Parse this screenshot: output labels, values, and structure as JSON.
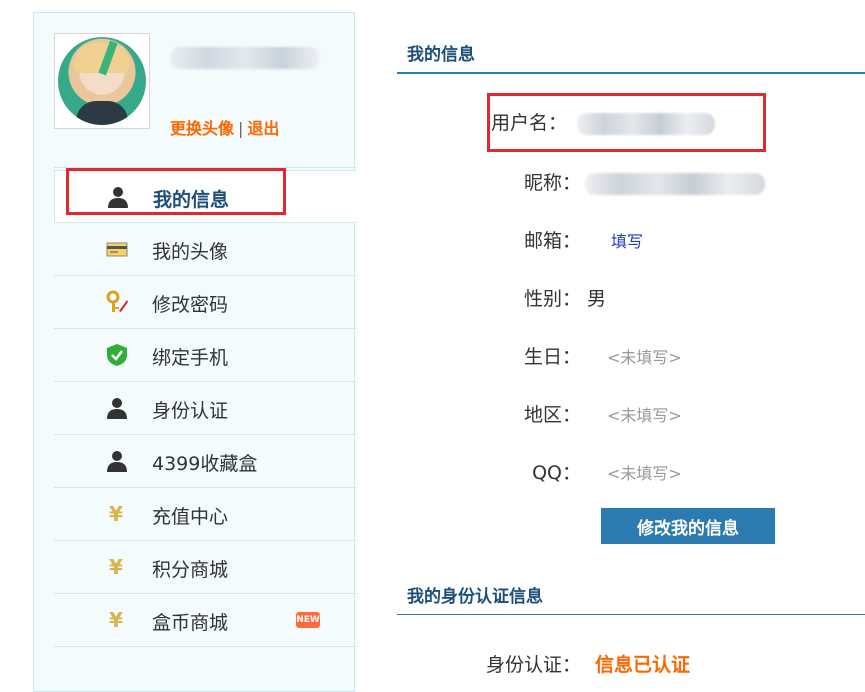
{
  "profile": {
    "change_avatar": "更换头像",
    "separator": "|",
    "logout": "退出"
  },
  "menu": [
    {
      "label": "我的信息",
      "icon": "user-icon",
      "active": true
    },
    {
      "label": "我的头像",
      "icon": "id-card-icon"
    },
    {
      "label": "修改密码",
      "icon": "key-pen-icon"
    },
    {
      "label": "绑定手机",
      "icon": "shield-check-icon"
    },
    {
      "label": "身份认证",
      "icon": "user-icon"
    },
    {
      "label": "4399收藏盒",
      "icon": "user-icon"
    },
    {
      "label": "充值中心",
      "icon": "yen-icon"
    },
    {
      "label": "积分商城",
      "icon": "yen-icon"
    },
    {
      "label": "盒币商城",
      "icon": "yen-icon",
      "badge": "NEW"
    }
  ],
  "info": {
    "title": "我的信息",
    "username_label": "用户名：",
    "nickname_label": "昵称：",
    "email_label": "邮箱：",
    "email_action": "填写",
    "gender_label": "性别：",
    "gender_value": "男",
    "birthday_label": "生日：",
    "birthday_value": "<未填写>",
    "region_label": "地区：",
    "region_value": "<未填写>",
    "qq_label": "QQ：",
    "qq_value": "<未填写>",
    "edit_button": "修改我的信息"
  },
  "identity": {
    "title": "我的身份认证信息",
    "label": "身份认证：",
    "status": "信息已认证"
  },
  "colors": {
    "accent_blue": "#2c7bb0",
    "title_blue": "#1d4f7a",
    "orange": "#ff6600",
    "highlight_red": "#e0282e"
  }
}
